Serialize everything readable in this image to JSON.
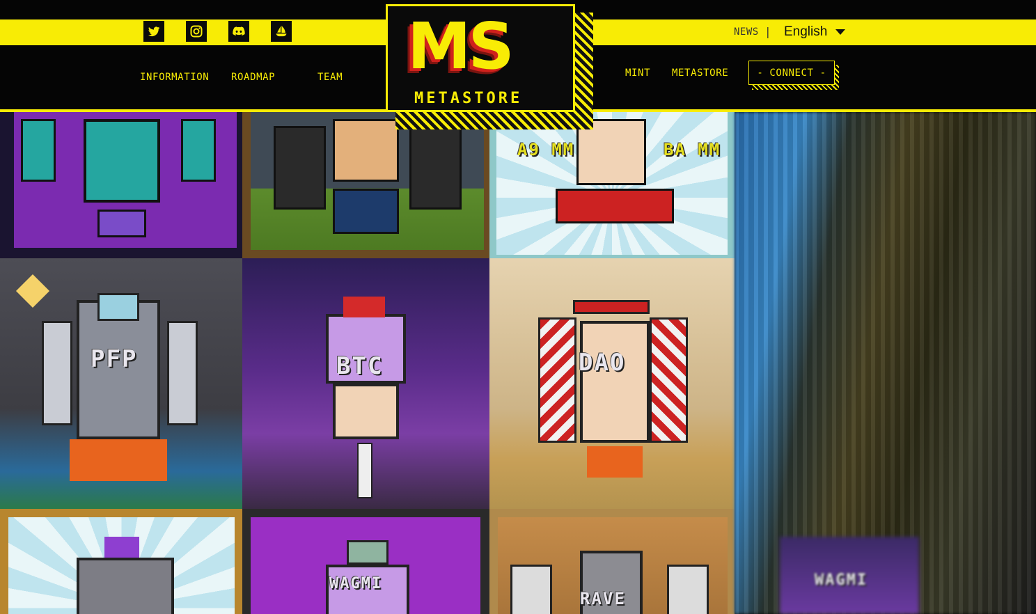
{
  "header": {
    "socials": [
      {
        "name": "twitter-icon"
      },
      {
        "name": "instagram-icon"
      },
      {
        "name": "discord-icon"
      },
      {
        "name": "opensea-icon"
      }
    ],
    "news_label": "NEWS",
    "separator": "|",
    "language": "English",
    "nav_left": [
      "INFORMATION",
      "ROADMAP",
      "TEAM"
    ],
    "nav_right": [
      "MINT",
      "METASTORE"
    ],
    "connect_label": "- CONNECT -"
  },
  "logo": {
    "monogram": "MS",
    "wordmark": "METASTORE"
  },
  "tiles": {
    "labels": [
      "PFP",
      "BTC",
      "DAO",
      "A9 MM",
      "BA MM",
      "WAGMI",
      "RAVE",
      "WAGMI"
    ]
  },
  "colors": {
    "accent": "#f8ec05",
    "background": "#050505",
    "logo_red": "#d0211c"
  }
}
